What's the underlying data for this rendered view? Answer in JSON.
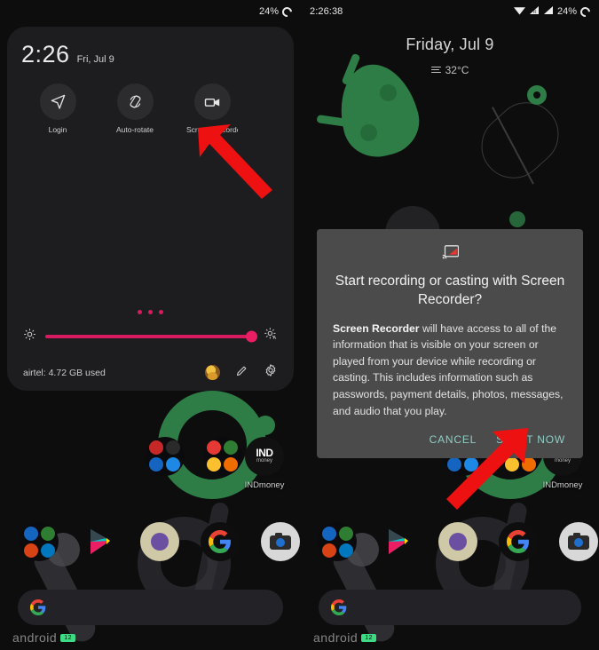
{
  "left_screen": {
    "statusbar": {
      "battery_percent": "24%"
    },
    "quick_settings": {
      "time": "2:26",
      "date": "Fri, Jul 9",
      "tiles": [
        {
          "label": "Login",
          "icon": "location-arrow-icon"
        },
        {
          "label": "Auto-rotate",
          "icon": "auto-rotate-icon"
        },
        {
          "label": "Screen Recorder",
          "icon": "video-camera-icon"
        }
      ],
      "page_dots": 3,
      "brightness_percent": 100,
      "brightness_low_icon": "brightness-low-icon",
      "brightness_auto_icon": "brightness-auto-icon",
      "footer": {
        "carrier_data": "airtel: 4.72 GB used",
        "avatar": "user-avatar",
        "edit_icon": "pencil-icon",
        "settings_icon": "gear-icon"
      }
    },
    "home": {
      "apps": [
        {
          "label": "INDmoney"
        }
      ],
      "search_placeholder": "",
      "watermark_text": "android",
      "watermark_badge": "12"
    },
    "annotation": {
      "arrow_target": "Screen Recorder tile",
      "color": "#ee1111"
    }
  },
  "right_screen": {
    "statusbar": {
      "time": "2:26:38",
      "battery_percent": "24%",
      "icons": [
        "wifi-icon",
        "signal-roaming-icon",
        "signal-icon",
        "battery-circle-icon"
      ]
    },
    "home": {
      "date": "Friday, Jul 9",
      "temperature": "32°C",
      "apps": [
        {
          "label": "INDmoney"
        }
      ],
      "watermark_text": "android",
      "watermark_badge": "12"
    },
    "dialog": {
      "icon": "cast-screen-icon",
      "title": "Start recording or casting with Screen Recorder?",
      "body_app_name": "Screen Recorder",
      "body_text": " will have access to all of the information that is visible on your screen or played from your device while recording or casting. This includes information such as passwords, payment details, photos, messages, and audio that you play.",
      "cancel_label": "CANCEL",
      "confirm_label": "START NOW",
      "accent_color": "#8ecdc4",
      "background_color": "#4b4b4b"
    },
    "annotation": {
      "arrow_target": "START NOW button",
      "color": "#ee1111"
    }
  }
}
